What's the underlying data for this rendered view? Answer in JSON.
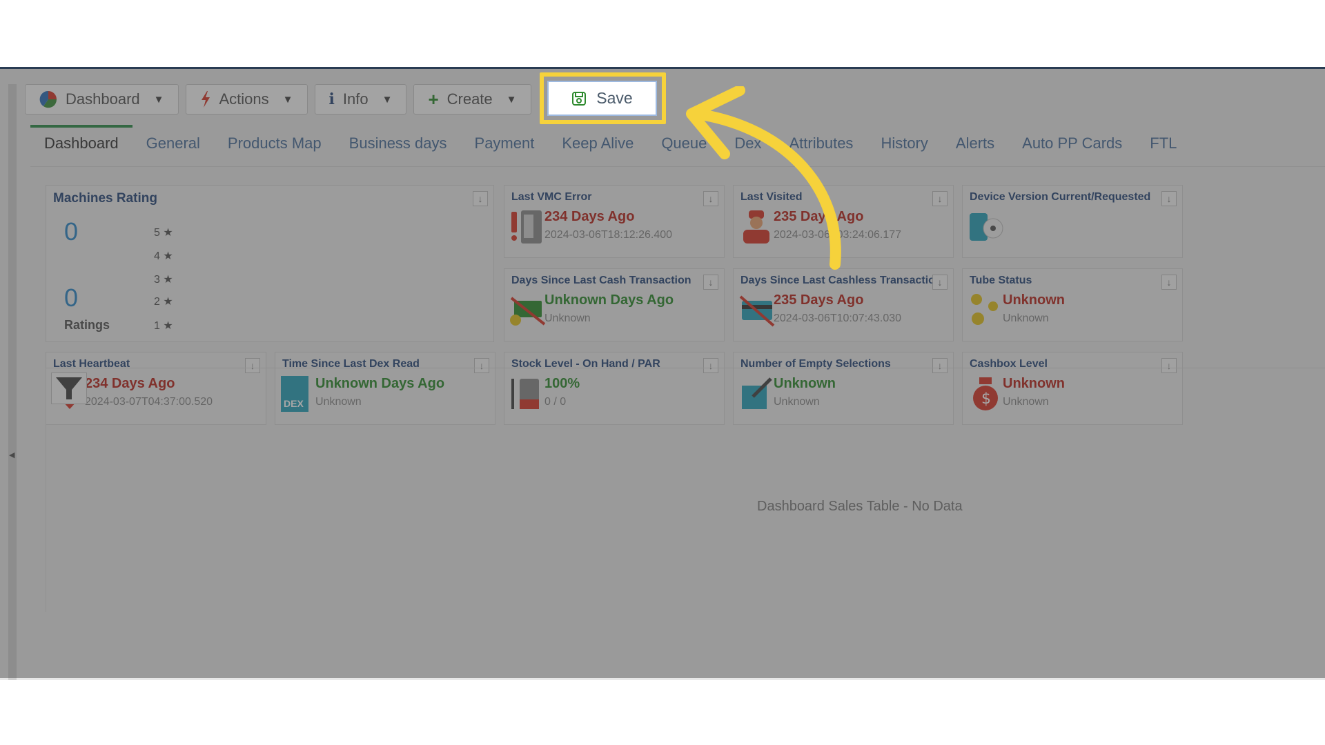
{
  "toolbar": {
    "dashboard": "Dashboard",
    "actions": "Actions",
    "info": "Info",
    "create": "Create",
    "save": "Save"
  },
  "tabs": [
    "Dashboard",
    "General",
    "Products Map",
    "Business days",
    "Payment",
    "Keep Alive",
    "Queue",
    "Dex",
    "Attributes",
    "History",
    "Alerts",
    "Auto PP Cards",
    "FTL"
  ],
  "machines_rating": {
    "title": "Machines Rating",
    "avg": "0",
    "count": "0",
    "ratings_label": "Ratings",
    "stars": [
      "5 ★",
      "4 ★",
      "3 ★",
      "2 ★",
      "1 ★"
    ]
  },
  "widgets": {
    "last_vmc_error": {
      "title": "Last VMC Error",
      "value": "234 Days Ago",
      "sub": "2024-03-06T18:12:26.400"
    },
    "last_visited": {
      "title": "Last Visited",
      "value": "235 Days Ago",
      "sub": "2024-03-06T03:24:06.177"
    },
    "device_version": {
      "title": "Device Version Current/Requested"
    },
    "cash_tx": {
      "title": "Days Since Last Cash Transaction",
      "value": "Unknown Days Ago",
      "sub": "Unknown"
    },
    "cashless_tx": {
      "title": "Days Since Last Cashless Transaction",
      "value": "235 Days Ago",
      "sub": "2024-03-06T10:07:43.030"
    },
    "tube_status": {
      "title": "Tube Status",
      "value": "Unknown",
      "sub": "Unknown"
    },
    "last_heartbeat": {
      "title": "Last Heartbeat",
      "value": "234 Days Ago",
      "sub": "2024-03-07T04:37:00.520"
    },
    "dex_read": {
      "title": "Time Since Last Dex Read",
      "value": "Unknown Days Ago",
      "sub": "Unknown",
      "icon_text": "DEX"
    },
    "stock_level": {
      "title": "Stock Level - On Hand / PAR",
      "value": "100%",
      "sub": "0 / 0"
    },
    "empty_selections": {
      "title": "Number of Empty Selections",
      "value": "Unknown",
      "sub": "Unknown"
    },
    "cashbox": {
      "title": "Cashbox Level",
      "value": "Unknown",
      "sub": "Unknown"
    }
  },
  "sales_table": {
    "empty_message": "Dashboard Sales Table - No Data"
  },
  "colors": {
    "accent": "#2e8c4a",
    "link": "#4a6e9a",
    "title": "#2a4a7a",
    "highlight": "#f6d23b",
    "danger": "#b8291f",
    "ok": "#2e8a2e"
  }
}
